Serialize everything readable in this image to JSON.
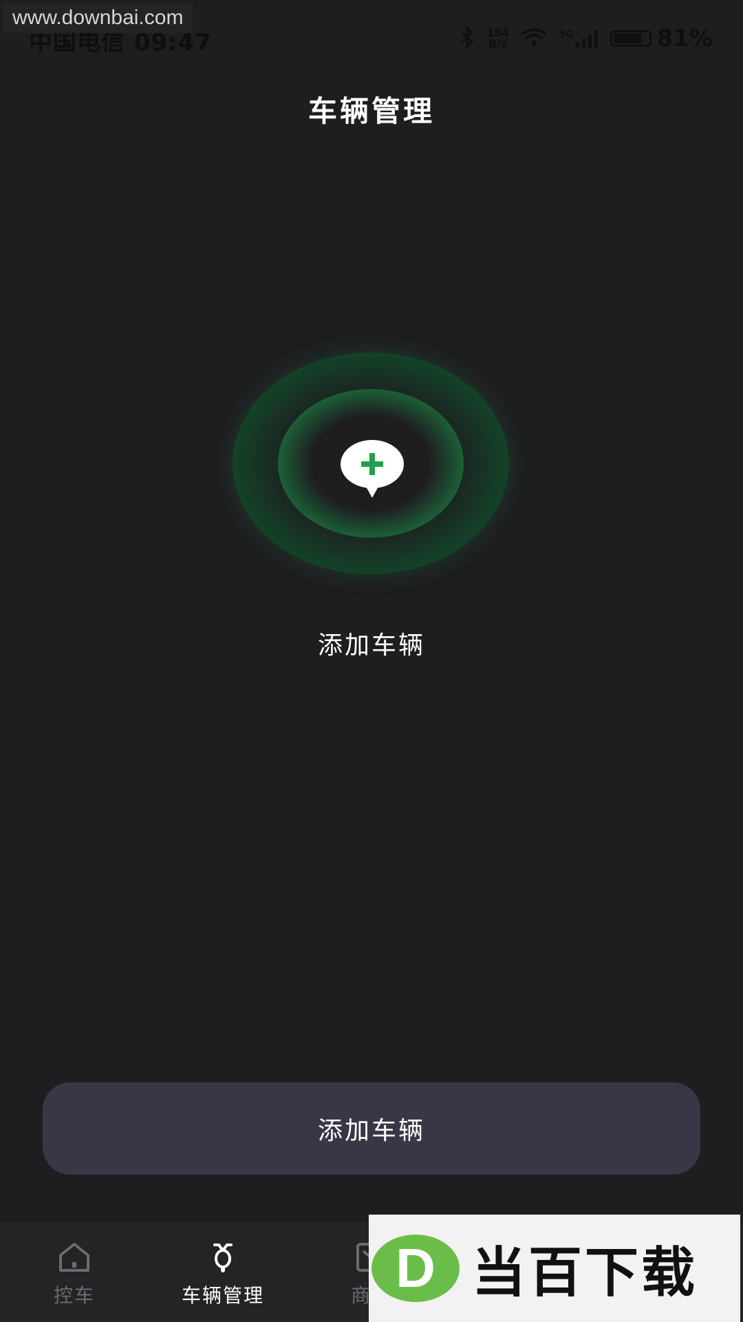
{
  "status_bar": {
    "watermark_url": "www.downbai.com",
    "carrier_time": "中国电信 09:47",
    "net_speed_value": "184",
    "net_speed_unit": "B/s",
    "network_type": "5G",
    "battery_percent": "81%",
    "battery_level": 0.81
  },
  "header": {
    "title": "车辆管理"
  },
  "main": {
    "add_label": "添加车辆",
    "add_button_label": "添加车辆"
  },
  "bottom_nav": {
    "items": [
      {
        "label": "控车",
        "icon": "home-icon",
        "active": false
      },
      {
        "label": "车辆管理",
        "icon": "scooter-icon",
        "active": true
      },
      {
        "label": "商城",
        "icon": "shop-icon",
        "active": false
      }
    ]
  },
  "watermark": {
    "logo_letter": "D",
    "brand_text": "当百下载"
  },
  "colors": {
    "background": "#1e1e21",
    "accent_green": "#2cb25f",
    "button_bg": "#393746",
    "nav_bg": "#242427",
    "nav_inactive": "#6b6b70"
  }
}
